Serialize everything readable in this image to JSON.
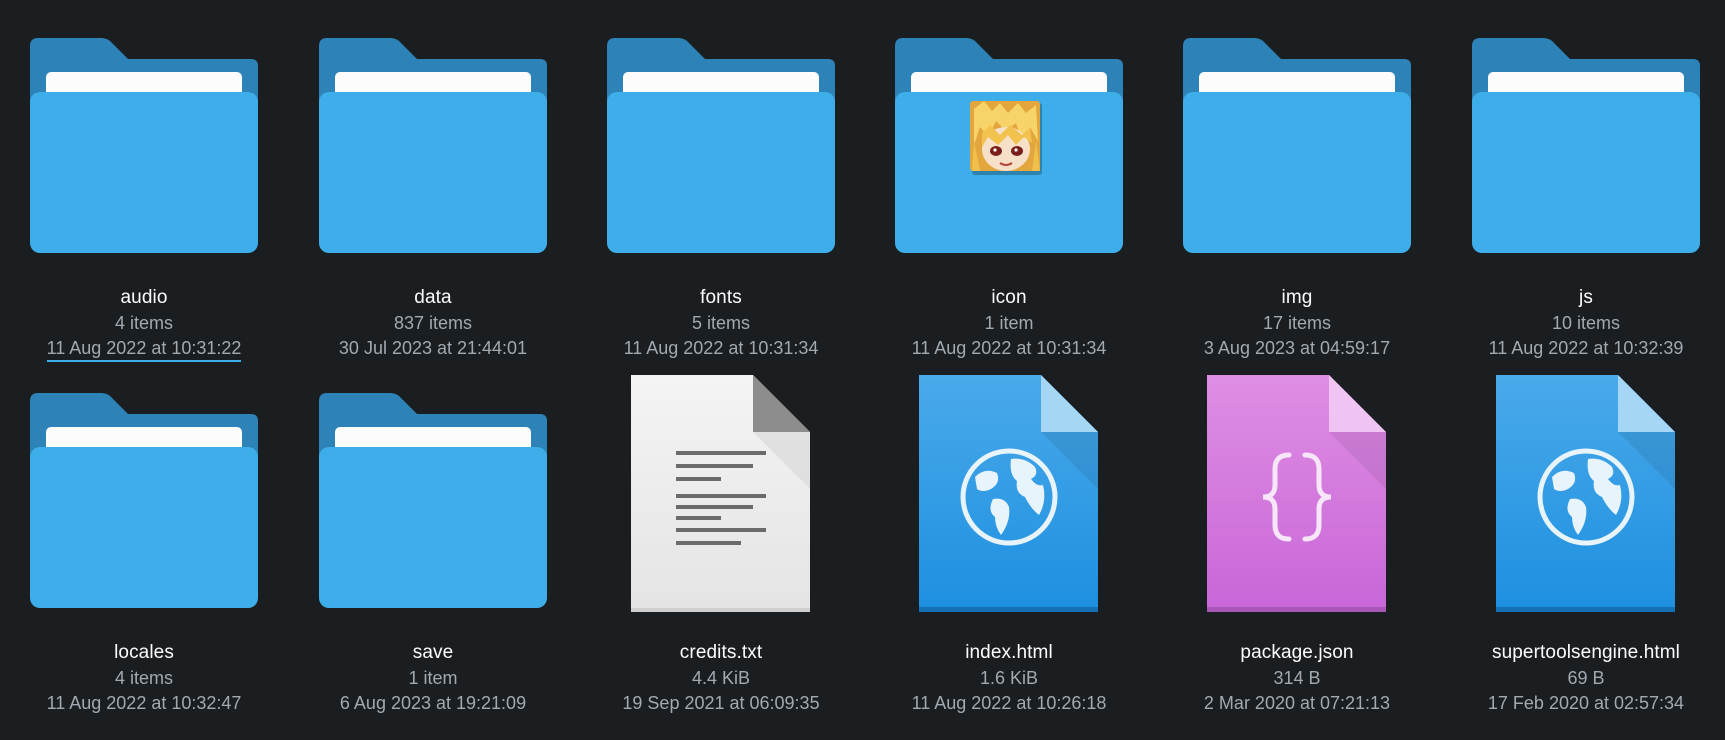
{
  "colors": {
    "background": "#1b1e20",
    "folder_back": "#2d83b8",
    "folder_front": "#3daee9",
    "paper": "#fcfcfc",
    "html_icon_top": "#45a8ea",
    "html_icon_bottom": "#1c8ee0",
    "json_icon": "#d97fdf",
    "text_icon": "#eeeeee",
    "name_text": "#fcfcfc",
    "meta_text": "#a1a9b1",
    "focus_underline": "#3daee9"
  },
  "items": [
    {
      "name": "audio",
      "count": "4 items",
      "date": "11 Aug 2022 at 10:31:22",
      "icon": "folder-icon"
    },
    {
      "name": "data",
      "count": "837 items",
      "date": "30 Jul 2023 at 21:44:01",
      "icon": "folder-icon"
    },
    {
      "name": "fonts",
      "count": "5 items",
      "date": "11 Aug 2022 at 10:31:34",
      "icon": "folder-icon"
    },
    {
      "name": "icon",
      "count": "1 item",
      "date": "11 Aug 2022 at 10:31:34",
      "icon": "folder-icon"
    },
    {
      "name": "img",
      "count": "17 items",
      "date": "3 Aug 2023 at 04:59:17",
      "icon": "folder-icon"
    },
    {
      "name": "js",
      "count": "10 items",
      "date": "11 Aug 2022 at 10:32:39",
      "icon": "folder-icon"
    },
    {
      "name": "locales",
      "count": "4 items",
      "date": "11 Aug 2022 at 10:32:47",
      "icon": "folder-icon"
    },
    {
      "name": "save",
      "count": "1 item",
      "date": "6 Aug 2023 at 19:21:09",
      "icon": "folder-icon"
    },
    {
      "name": "credits.txt",
      "count": "4.4 KiB",
      "date": "19 Sep 2021 at 06:09:35",
      "icon": "text-file-icon"
    },
    {
      "name": "index.html",
      "count": "1.6 KiB",
      "date": "11 Aug 2022 at 10:26:18",
      "icon": "html-file-icon"
    },
    {
      "name": "package.json",
      "count": "314 B",
      "date": "2 Mar 2020 at 07:21:13",
      "icon": "json-file-icon"
    },
    {
      "name": "supertoolsengine.html",
      "count": "69 B",
      "date": "17 Feb 2020 at 02:57:34",
      "icon": "html-file-icon"
    }
  ]
}
